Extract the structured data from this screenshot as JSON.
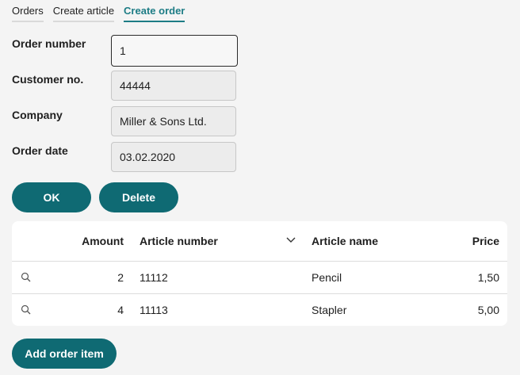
{
  "tabs": [
    {
      "label": "Orders",
      "active": false
    },
    {
      "label": "Create article",
      "active": false
    },
    {
      "label": "Create order",
      "active": true
    }
  ],
  "form": {
    "order_number": {
      "label": "Order number",
      "value": "1"
    },
    "customer_no": {
      "label": "Customer no.",
      "value": "44444"
    },
    "company": {
      "label": "Company",
      "value": "Miller & Sons Ltd."
    },
    "order_date": {
      "label": "Order date",
      "value": "03.02.2020"
    }
  },
  "actions": {
    "ok_label": "OK",
    "delete_label": "Delete"
  },
  "table": {
    "headers": {
      "amount": "Amount",
      "article_number": "Article number",
      "article_name": "Article name",
      "price": "Price"
    },
    "rows": [
      {
        "amount": "2",
        "article_number": "11112",
        "article_name": "Pencil",
        "price": "1,50"
      },
      {
        "amount": "4",
        "article_number": "11113",
        "article_name": "Stapler",
        "price": "5,00"
      }
    ]
  },
  "add_item_label": "Add order item",
  "colors": {
    "accent": "#0f6a73",
    "active_tab": "#1d7c85",
    "background": "#f4f4f4"
  },
  "icons": {
    "row_action": "search-icon",
    "sort": "chevron-down-icon"
  }
}
